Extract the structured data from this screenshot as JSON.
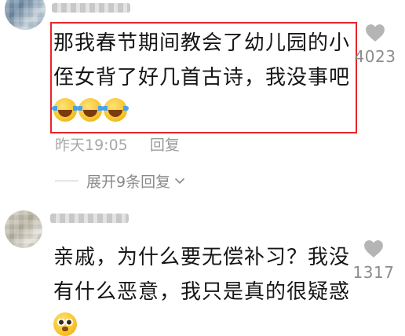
{
  "comments": [
    {
      "text": "那我春节期间教会了幼儿园的小侄女背了好几首古诗，我没事吧",
      "emojis": [
        "face-with-tears-of-joy",
        "face-with-tears-of-joy",
        "face-with-tears-of-joy"
      ],
      "time": "昨天19:05",
      "reply_label": "回复",
      "likes": "4023",
      "highlighted": true,
      "expand_replies_label": "展开9条回复"
    },
    {
      "text": "亲戚，为什么要无偿补习？我没有什么恶意，我只是真的很疑惑",
      "emojis": [
        "pleading-face"
      ],
      "likes": "1317"
    }
  ],
  "colors": {
    "highlight_border": "#e8242b",
    "secondary_text": "#a8a8a8",
    "like_gray": "#b5b5b5"
  }
}
